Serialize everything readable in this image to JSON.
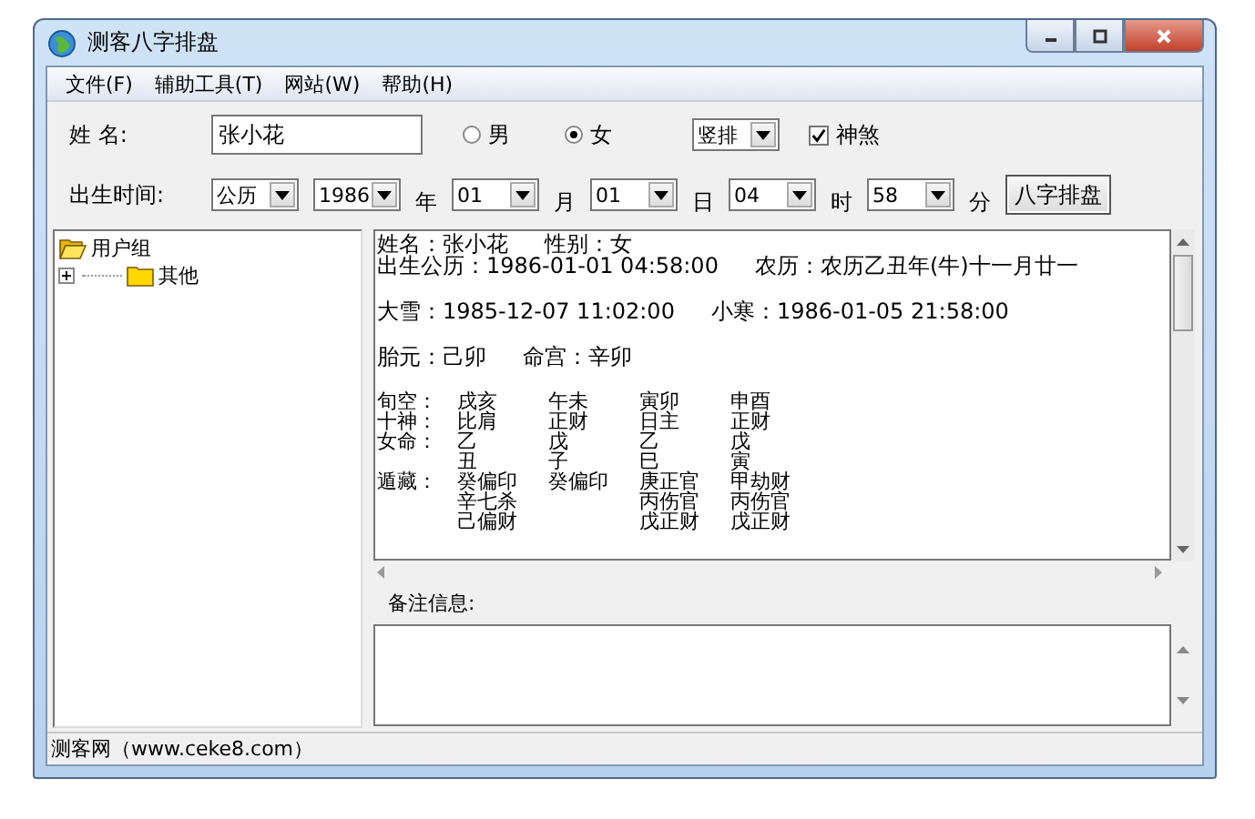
{
  "window": {
    "title": "测客八字排盘"
  },
  "menu": [
    "文件(F)",
    "辅助工具(T)",
    "网站(W)",
    "帮助(H)"
  ],
  "name_row": {
    "label": "姓  名:",
    "value": "张小花",
    "genders": [
      {
        "label": "男",
        "selected": false
      },
      {
        "label": "女",
        "selected": true
      }
    ],
    "layout_select": "竖排",
    "shensha": {
      "label": "神煞",
      "checked": true
    }
  },
  "time_row": {
    "label": "出生时间:",
    "fields": [
      {
        "value": "公历"
      },
      {
        "value": "1986",
        "unit": "年"
      },
      {
        "value": "01",
        "unit": "月"
      },
      {
        "value": "01",
        "unit": "日"
      },
      {
        "value": "04",
        "unit": "时"
      },
      {
        "value": "58",
        "unit": "分"
      }
    ],
    "button": "八字排盘"
  },
  "tree": [
    {
      "label": "用户组",
      "expanded": true,
      "children": [
        {
          "label": "其他",
          "expanded": false
        }
      ]
    }
  ],
  "result": {
    "lines": [
      {
        "parts": [
          "姓名：张小花",
          "性别：女"
        ],
        "gap_after": false
      },
      {
        "parts": [
          "出生公历：1986-01-01 04:58:00",
          "农历：农历乙丑年(牛)十一月廿一"
        ],
        "gap_after": true
      },
      {
        "parts": [
          "大雪：1985-12-07 11:02:00",
          "小寒：1986-01-05 21:58:00"
        ],
        "gap_after": true
      },
      {
        "parts": [
          "胎元：己卯",
          "命宫：辛卯"
        ],
        "gap_after": true
      }
    ],
    "table": [
      {
        "label": "旬空：",
        "cells": [
          [
            "戌亥"
          ],
          [
            "午未"
          ],
          [
            "寅卯"
          ],
          [
            "申酉"
          ]
        ]
      },
      {
        "label": "十神：",
        "cells": [
          [
            "比肩"
          ],
          [
            "正财"
          ],
          [
            "日主"
          ],
          [
            "正财"
          ]
        ]
      },
      {
        "label": "女命：",
        "cells": [
          [
            "乙"
          ],
          [
            "戊"
          ],
          [
            "乙"
          ],
          [
            "戊"
          ]
        ]
      },
      {
        "cells": [
          [
            "丑"
          ],
          [
            "子"
          ],
          [
            "巳"
          ],
          [
            "寅"
          ]
        ]
      },
      {
        "label": "遁藏：",
        "cells": [
          [
            "癸偏印",
            "辛七杀",
            "己偏财"
          ],
          [
            "癸偏印"
          ],
          [
            "庚正官",
            "丙伤官",
            "戊正财"
          ],
          [
            "甲劫财",
            "丙伤官",
            "戊正财"
          ]
        ]
      }
    ]
  },
  "notes": {
    "label": "备注信息:"
  },
  "status_bar": "测客网（www.ceke8.com）"
}
